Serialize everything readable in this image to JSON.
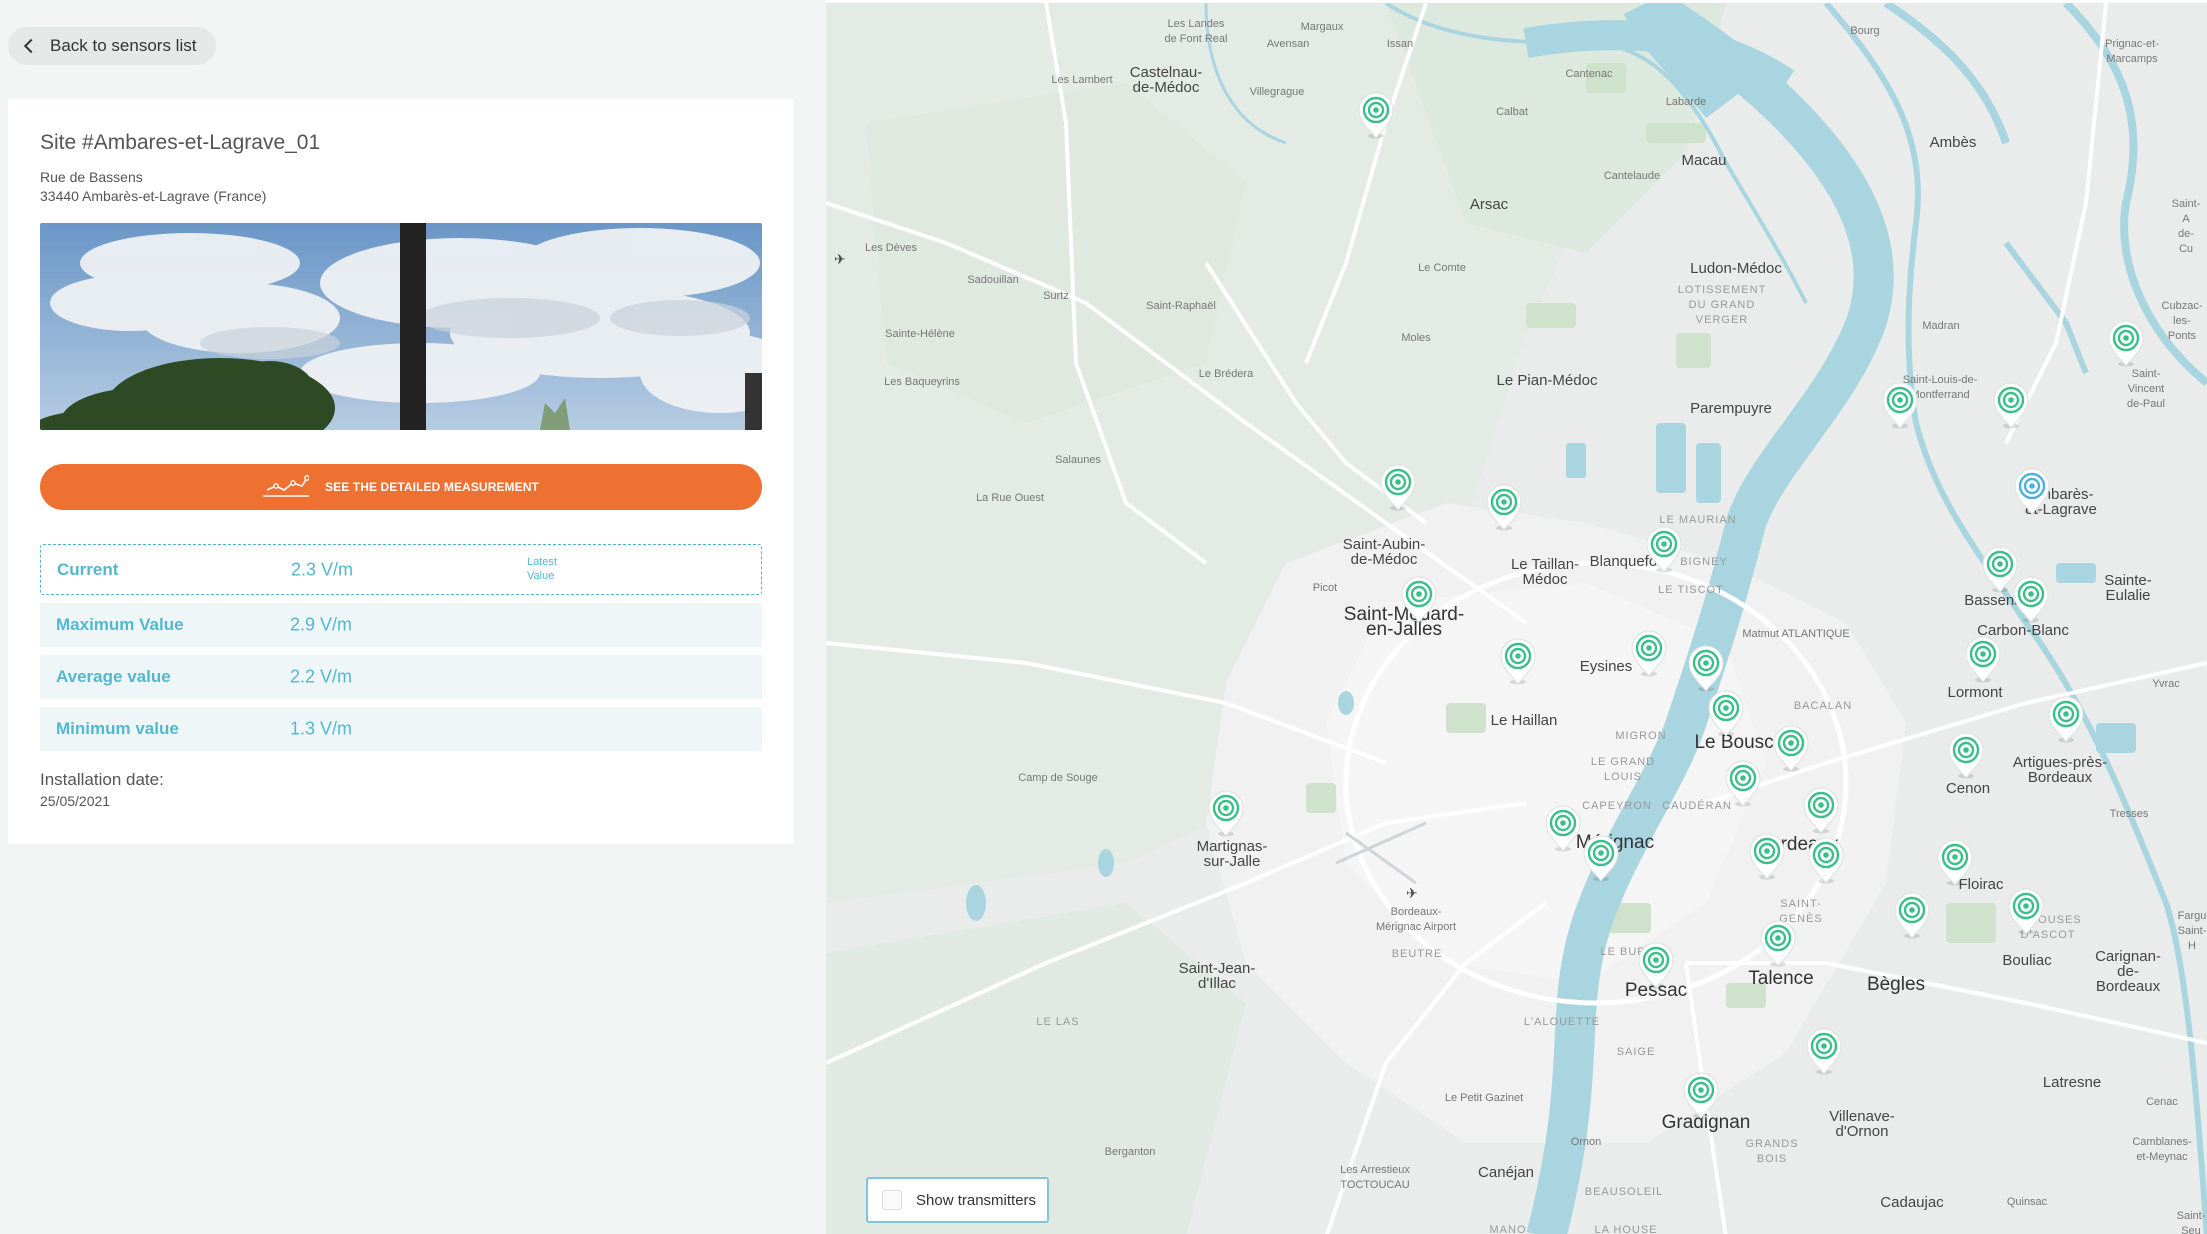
{
  "back_button": {
    "label": "Back to sensors list"
  },
  "site": {
    "title": "Site #Ambares-et-Lagrave_01",
    "address_line1": "Rue de Bassens",
    "address_line2": "33440 Ambarès-et-Lagrave (France)"
  },
  "cta": {
    "label": "SEE THE DETAILED MEASUREMENT",
    "color": "#ef7131"
  },
  "measurements": {
    "current": {
      "label": "Current",
      "value": "2.3 V/m",
      "note_line1": "Latest",
      "note_line2": "Value"
    },
    "max": {
      "label": "Maximum Value",
      "value": "2.9 V/m"
    },
    "avg": {
      "label": "Average value",
      "value": "2.2 V/m"
    },
    "min": {
      "label": "Minimum value",
      "value": "1.3 V/m"
    }
  },
  "installation": {
    "label": "Installation date:",
    "date": "25/05/2021"
  },
  "map": {
    "transmitters_toggle": {
      "label": "Show transmitters",
      "checked": false
    },
    "accent_color": "#55b7cf",
    "pin_color": "#3bbf8a",
    "selected_pin_color": "#4ab1de",
    "places": [
      {
        "t": "Les Landes\nde Font Real",
        "c": "small"
      },
      {
        "t": "Margaux",
        "c": "small"
      },
      {
        "t": "Issan",
        "c": "small"
      },
      {
        "t": "Bourg",
        "c": "small"
      },
      {
        "t": "Prignac-et-\nMarcamps",
        "c": "small"
      },
      {
        "t": "Castelnau-\nde-Médoc",
        "c": "big"
      },
      {
        "t": "Avensan",
        "c": "small"
      },
      {
        "t": "Cantenac",
        "c": "small"
      },
      {
        "t": "Les Lambert",
        "c": "small"
      },
      {
        "t": "Villegrague",
        "c": "small"
      },
      {
        "t": "Labarde",
        "c": "small"
      },
      {
        "t": "Calbat",
        "c": "small"
      },
      {
        "t": "Ambès",
        "c": "big"
      },
      {
        "t": "Macau",
        "c": "big"
      },
      {
        "t": "Cantelaude",
        "c": "small"
      },
      {
        "t": "Arsac",
        "c": "big"
      },
      {
        "t": "Saint-A\nde-Cu",
        "c": "small"
      },
      {
        "t": "Les Dèves",
        "c": "small"
      },
      {
        "t": "Le Comte",
        "c": "small"
      },
      {
        "t": "Ludon-Médoc",
        "c": "big"
      },
      {
        "t": "LOTISSEMENT\nDU GRAND\nVERGER",
        "c": "district"
      },
      {
        "t": "Sadouillan",
        "c": "small"
      },
      {
        "t": "Surtz",
        "c": "small"
      },
      {
        "t": "Saint-Raphaël",
        "c": "small"
      },
      {
        "t": "Madran",
        "c": "small"
      },
      {
        "t": "Cubzac-\nles-Ponts",
        "c": "small"
      },
      {
        "t": "Sainte-Hélène",
        "c": "small"
      },
      {
        "t": "Moles",
        "c": "small"
      },
      {
        "t": "Saint-Vincent\nde-Paul",
        "c": "small"
      },
      {
        "t": "Les Baqueyrins",
        "c": "small"
      },
      {
        "t": "Le Brédera",
        "c": "small"
      },
      {
        "t": "Le Pian-Médoc",
        "c": "big"
      },
      {
        "t": "Saint-Louis-de-\nMontferrand",
        "c": "small"
      },
      {
        "t": "Parempuyre",
        "c": "big"
      },
      {
        "t": "Salaunes",
        "c": "small"
      },
      {
        "t": "La Rue Ouest",
        "c": "small"
      },
      {
        "t": "Ambarès-\net-Lagrave",
        "c": "big"
      },
      {
        "t": "LE MAURIAN",
        "c": "district"
      },
      {
        "t": "Saint-Aubin-\nde-Médoc",
        "c": "big"
      },
      {
        "t": "Blanquefort",
        "c": "big"
      },
      {
        "t": "BIGNEY",
        "c": "district"
      },
      {
        "t": "Le Taillan-\nMédoc",
        "c": "big"
      },
      {
        "t": "LE TISCOT",
        "c": "district"
      },
      {
        "t": "Sainte-Eulalie",
        "c": "big"
      },
      {
        "t": "Picot",
        "c": "small"
      },
      {
        "t": "Saint-Médard-\nen-Jalles",
        "c": "city"
      },
      {
        "t": "Bassens",
        "c": "big"
      },
      {
        "t": "Carbon-Blanc",
        "c": "big"
      },
      {
        "t": "Matmut ATLANTIQUE",
        "c": "small"
      },
      {
        "t": "Eysines",
        "c": "big"
      },
      {
        "t": "Lormont",
        "c": "big"
      },
      {
        "t": "Yvrac",
        "c": "small"
      },
      {
        "t": "Le Haillan",
        "c": "big"
      },
      {
        "t": "BACALAN",
        "c": "district"
      },
      {
        "t": "MIGRON",
        "c": "district"
      },
      {
        "t": "Le Bouscat",
        "c": "city"
      },
      {
        "t": "Artigues-près-\nBordeaux",
        "c": "big"
      },
      {
        "t": "LE GRAND\nLOUIS",
        "c": "district"
      },
      {
        "t": "Camp de Souge",
        "c": "small"
      },
      {
        "t": "Cenon",
        "c": "big"
      },
      {
        "t": "CAPEYRON",
        "c": "district"
      },
      {
        "t": "CAUDÉRAN",
        "c": "district"
      },
      {
        "t": "Tresses",
        "c": "small"
      },
      {
        "t": "Martignas-\nsur-Jalle",
        "c": "big"
      },
      {
        "t": "Mérignac",
        "c": "city"
      },
      {
        "t": "Bordeaux",
        "c": "city"
      },
      {
        "t": "Floirac",
        "c": "big"
      },
      {
        "t": "Fargu\nSaint-H",
        "c": "small"
      },
      {
        "t": "SAINT-\nGENÈS",
        "c": "district"
      },
      {
        "t": "Bordeaux-\nMérignac Airport",
        "c": "small"
      },
      {
        "t": "PELOUSES\nD'ASCOT",
        "c": "district"
      },
      {
        "t": "BEUTRE",
        "c": "district"
      },
      {
        "t": "Saint-Jean-\nd'Illac",
        "c": "big"
      },
      {
        "t": "LE BURCK",
        "c": "district"
      },
      {
        "t": "Bouliac",
        "c": "big"
      },
      {
        "t": "Carignan-de-\nBordeaux",
        "c": "big"
      },
      {
        "t": "Talence",
        "c": "city"
      },
      {
        "t": "Pessac",
        "c": "city"
      },
      {
        "t": "Bègles",
        "c": "city"
      },
      {
        "t": "LE LAS",
        "c": "district"
      },
      {
        "t": "L'ALOUETTE",
        "c": "district"
      },
      {
        "t": "SAIGE",
        "c": "district"
      },
      {
        "t": "Latresne",
        "c": "big"
      },
      {
        "t": "Le Petit Gazinet",
        "c": "small"
      },
      {
        "t": "Cenac",
        "c": "small"
      },
      {
        "t": "Gradignan",
        "c": "city"
      },
      {
        "t": "Villenave-\nd'Ornon",
        "c": "big"
      },
      {
        "t": "Ornon",
        "c": "small"
      },
      {
        "t": "GRANDS\nBOIS",
        "c": "district"
      },
      {
        "t": "Berganton",
        "c": "small"
      },
      {
        "t": "Camblanes-\net-Meynac",
        "c": "small"
      },
      {
        "t": "Les Arrestieux\nTOCTOUCAU",
        "c": "small"
      },
      {
        "t": "Canéjan",
        "c": "big"
      },
      {
        "t": "BEAUSOLEIL",
        "c": "district"
      },
      {
        "t": "Quinsac",
        "c": "small"
      },
      {
        "t": "Cadaujac",
        "c": "big"
      },
      {
        "t": "Saint-\nSeu",
        "c": "small"
      },
      {
        "t": "LA HOUSE",
        "c": "district"
      },
      {
        "t": "MANO",
        "c": "district"
      }
    ]
  }
}
